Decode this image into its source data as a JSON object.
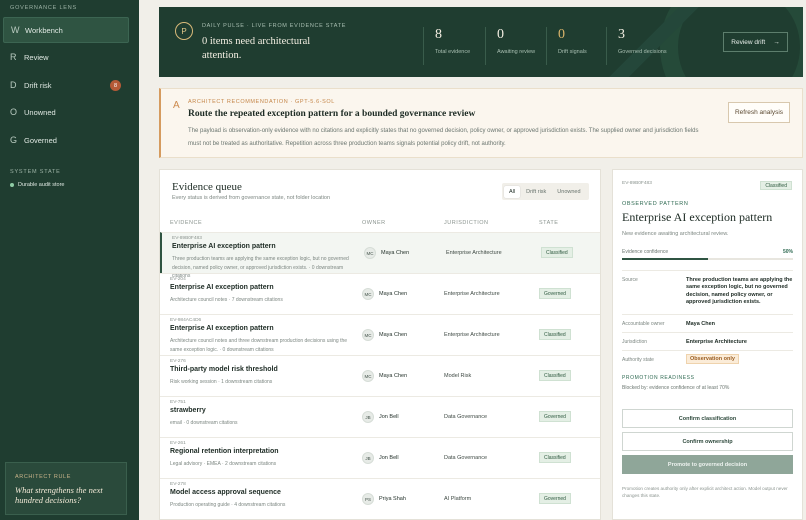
{
  "sidebar": {
    "lens_label": "GOVERNANCE LENS",
    "items": [
      {
        "letter": "W",
        "label": "Workbench",
        "active": true
      },
      {
        "letter": "R",
        "label": "Review"
      },
      {
        "letter": "D",
        "label": "Drift risk",
        "badge": "8"
      },
      {
        "letter": "O",
        "label": "Unowned"
      },
      {
        "letter": "G",
        "label": "Governed"
      }
    ],
    "system_label": "SYSTEM STATE",
    "system_item": "Durable audit store",
    "rule_label": "ARCHITECT RULE",
    "rule_question": "What strengthens the next hundred decisions?"
  },
  "pulse": {
    "circle": "P",
    "eyebrow": "DAILY PULSE · LIVE FROM EVIDENCE STATE",
    "headline": "0 items need architectural attention.",
    "stats": [
      {
        "value": "8",
        "label": "Total evidence"
      },
      {
        "value": "0",
        "label": "Awaiting review"
      },
      {
        "value": "0",
        "label": "Drift signals"
      },
      {
        "value": "3",
        "label": "Governed decisions"
      }
    ],
    "button": "Review drift",
    "button_icon": "→"
  },
  "recommendation": {
    "letter": "A",
    "eyebrow": "ARCHITECT RECOMMENDATION · GPT-5.6-SOL",
    "title": "Route the repeated exception pattern for a bounded governance review",
    "body": "The payload is observation-only evidence with no citations and explicitly states that no governed decision, policy owner, or approved jurisdiction exists. The supplied owner and jurisdiction fields must not be treated as authoritative. Repetition across three production teams signals potential policy drift, not authority.",
    "button": "Refresh analysis"
  },
  "queue": {
    "title": "Evidence queue",
    "subtitle": "Every status is derived from governance state, not folder location",
    "filters": [
      "All",
      "Drift risk",
      "Unowned"
    ],
    "active_filter": "All",
    "columns": [
      "EVIDENCE",
      "OWNER",
      "JURISDICTION",
      "STATE"
    ],
    "rows": [
      {
        "id": "EV-89B0F483",
        "title": "Enterprise AI exception pattern",
        "meta": "Three production teams are applying the same exception logic, but no governed decision, named policy owner, or approved jurisdiction exists. · 0 downstream citations",
        "initials": "MC",
        "owner": "Maya Chen",
        "jurisdiction": "Enterprise Architecture",
        "state": "Classified"
      },
      {
        "id": "EV-204",
        "title": "Enterprise AI exception pattern",
        "meta": "Architecture council notes · 7 downstream citations",
        "initials": "MC",
        "owner": "Maya Chen",
        "jurisdiction": "Enterprise Architecture",
        "state": "Governed"
      },
      {
        "id": "EV-984AC4D6",
        "title": "Enterprise AI exception pattern",
        "meta": "Architecture council notes and three downstream production decisions using the same exception logic. · 0 downstream citations",
        "initials": "MC",
        "owner": "Maya Chen",
        "jurisdiction": "Enterprise Architecture",
        "state": "Classified"
      },
      {
        "id": "EV-276",
        "title": "Third-party model risk threshold",
        "meta": "Risk working session · 1 downstream citations",
        "initials": "MC",
        "owner": "Maya Chen",
        "jurisdiction": "Model Risk",
        "state": "Classified"
      },
      {
        "id": "EV-751",
        "title": "strawberry",
        "meta": "email · 0 downstream citations",
        "initials": "JB",
        "owner": "Jon Bell",
        "jurisdiction": "Data Governance",
        "state": "Governed"
      },
      {
        "id": "EV-261",
        "title": "Regional retention interpretation",
        "meta": "Legal advisory · EMEA · 2 downstream citations",
        "initials": "JB",
        "owner": "Jon Bell",
        "jurisdiction": "Data Governance",
        "state": "Classified"
      },
      {
        "id": "EV-278",
        "title": "Model access approval sequence",
        "meta": "Production operating guide · 4 downstream citations",
        "initials": "PS",
        "owner": "Priya Shah",
        "jurisdiction": "AI Platform",
        "state": "Governed"
      }
    ]
  },
  "detail": {
    "id": "EV-89B0F483",
    "badge": "Classified",
    "eyebrow": "OBSERVED PATTERN",
    "title": "Enterprise AI exception pattern",
    "subtitle": "New evidence awaiting architectural review.",
    "confidence_label": "Evidence confidence",
    "confidence_value": "50%",
    "confidence_fraction": 0.5,
    "fields": [
      {
        "key": "Source",
        "value": "Three production teams are applying the same exception logic, but no governed decision, named policy owner, or approved jurisdiction exists."
      },
      {
        "key": "Accountable owner",
        "value": "Maya Chen"
      },
      {
        "key": "Jurisdiction",
        "value": "Enterprise Architecture"
      },
      {
        "key": "Authority state",
        "value": "Observation only"
      }
    ],
    "readiness_label": "PROMOTION READINESS",
    "readiness_text": "Blocked by: evidence confidence of at least 70%",
    "buttons": [
      "Confirm classification",
      "Confirm ownership",
      "Promote to governed decision"
    ],
    "footnote": "Promotion creates authority only after explicit architect action. Model output never changes this state."
  }
}
